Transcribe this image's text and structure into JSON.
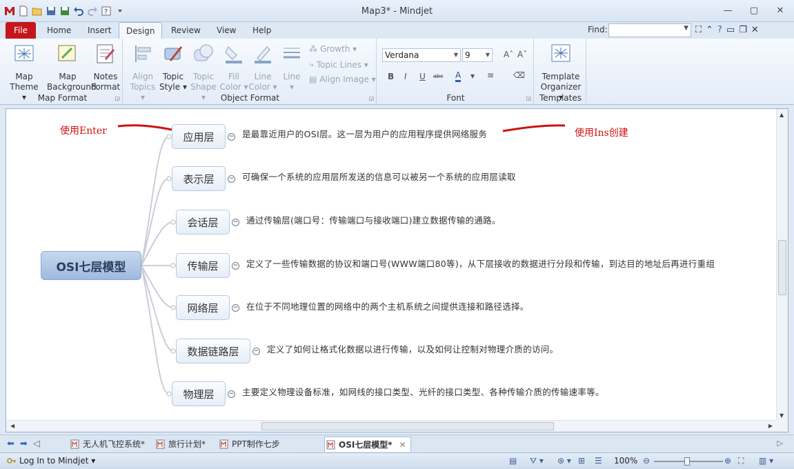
{
  "window": {
    "title": "Map3* - Mindjet"
  },
  "ribbon_tabs": [
    "File",
    "Home",
    "Insert",
    "Design",
    "Review",
    "View",
    "Help"
  ],
  "active_tab": "Design",
  "find": {
    "label": "Find:",
    "value": ""
  },
  "groups": {
    "map_format": {
      "label": "Map Format",
      "map_theme": [
        "Map",
        "Theme ▾"
      ],
      "map_background": [
        "Map",
        "Background"
      ],
      "notes_format": [
        "Notes",
        "Format"
      ]
    },
    "object_format": {
      "label": "Object Format",
      "align_topics": [
        "Align",
        "Topics ▾"
      ],
      "topic_style": [
        "Topic",
        "Style ▾"
      ],
      "topic_shape": [
        "Topic",
        "Shape ▾"
      ],
      "fill_color": [
        "Fill",
        "Color ▾"
      ],
      "line_color": [
        "Line",
        "Color ▾"
      ],
      "line": [
        "Line",
        "▾"
      ],
      "growth": "Growth ▾",
      "topic_lines": "Topic Lines ▾",
      "align_image": "Align Image ▾"
    },
    "font": {
      "label": "Font",
      "family": "Verdana",
      "size": "9"
    },
    "templates": {
      "label": "Templates",
      "template_organizer": [
        "Template",
        "Organizer ▾"
      ]
    }
  },
  "map": {
    "central": "OSI七层模型",
    "topics": [
      {
        "label": "应用层",
        "note": "是最靠近用户的OSI层。这一层为用户的应用程序提供网络服务"
      },
      {
        "label": "表示层",
        "note": "可确保一个系统的应用层所发送的信息可以被另一个系统的应用层读取"
      },
      {
        "label": "会话层",
        "note": "通过传输层(端口号：传输端口与接收端口)建立数据传输的通路。"
      },
      {
        "label": "传输层",
        "note": "定义了一些传输数据的协议和端口号(WWW端口80等)，从下层接收的数据进行分段和传输，到达目的地址后再进行重组"
      },
      {
        "label": "网络层",
        "note": "在位于不同地理位置的网络中的两个主机系统之间提供连接和路径选择。"
      },
      {
        "label": "数据链路层",
        "note": "定义了如何让格式化数据以进行传输，以及如何让控制对物理介质的访问。"
      },
      {
        "label": "物理层",
        "note": "主要定义物理设备标准，如网线的接口类型、光纤的接口类型、各种传输介质的传输速率等。"
      }
    ],
    "annotations": {
      "left": "使用Enter",
      "right": "使用Ins创建",
      "color": "#d01010"
    }
  },
  "doc_tabs": [
    "无人机飞控系统*",
    "旅行计划*",
    "PPT制作七步法.mmap*",
    "OSI七层模型*"
  ],
  "status": {
    "login": "Log In to Mindjet ▾",
    "zoom": "100%"
  }
}
